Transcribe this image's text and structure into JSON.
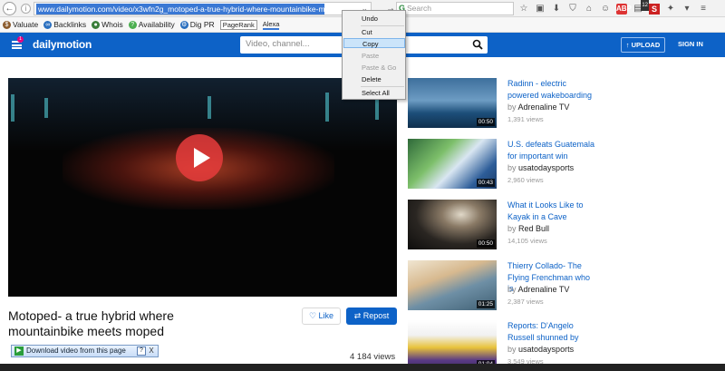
{
  "browser": {
    "url": "www.dailymotion.com/video/x3wfn2g_motoped-a-true-hybrid-where-mountainbike-meets-moped_sport",
    "search_placeholder": "Search",
    "badge_count": "12"
  },
  "bookmarks": {
    "items": [
      "Valuate",
      "Backlinks",
      "Whois",
      "Availability",
      "Dig PR"
    ],
    "pagerank": "PageRank",
    "alexa": "Alexa"
  },
  "header": {
    "logo": "dailymotion",
    "search_placeholder": "Video, channel...",
    "upload_label": "↑ UPLOAD",
    "signin_label": "SIGN IN",
    "brand_color": "#0d62c7"
  },
  "video": {
    "title": "Motoped- a true hybrid where mountainbike meets moped",
    "like_label": "Like",
    "repost_label": "Repost",
    "views": "4 184 views"
  },
  "downloader": {
    "label": "Download video from this page",
    "help": "?",
    "close": "X"
  },
  "related": [
    {
      "title": "Radinn - electric powered wakeboarding",
      "by": "by",
      "channel": "Adrenaline TV",
      "views": "1,391 views",
      "duration": "00:50"
    },
    {
      "title": "U.S. defeats Guatemala for important win",
      "by": "by",
      "channel": "usatodaysports",
      "views": "2,960 views",
      "duration": "00:43"
    },
    {
      "title": "What it Looks Like to Kayak in a Cave",
      "by": "by",
      "channel": "Red Bull",
      "views": "14,105 views",
      "duration": "00:50"
    },
    {
      "title": "Thierry Collado- The Flying Frenchman who is",
      "by": "by",
      "channel": "Adrenaline TV",
      "views": "2,387 views",
      "duration": "01:25"
    },
    {
      "title": "Reports: D'Angelo Russell shunned by",
      "by": "by",
      "channel": "usatodaysports",
      "views": "3,549 views",
      "duration": "01:04"
    }
  ],
  "context_menu": {
    "undo": "Undo",
    "cut": "Cut",
    "copy": "Copy",
    "paste": "Paste",
    "paste_go": "Paste & Go",
    "delete": "Delete",
    "select_all": "Select All"
  }
}
